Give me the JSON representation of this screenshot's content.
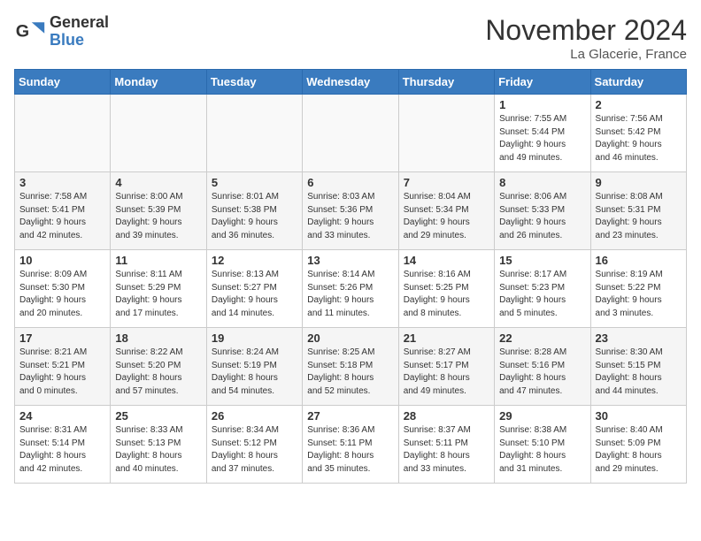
{
  "header": {
    "logo_line1": "General",
    "logo_line2": "Blue",
    "month": "November 2024",
    "location": "La Glacerie, France"
  },
  "days_of_week": [
    "Sunday",
    "Monday",
    "Tuesday",
    "Wednesday",
    "Thursday",
    "Friday",
    "Saturday"
  ],
  "weeks": [
    [
      {
        "day": "",
        "info": ""
      },
      {
        "day": "",
        "info": ""
      },
      {
        "day": "",
        "info": ""
      },
      {
        "day": "",
        "info": ""
      },
      {
        "day": "",
        "info": ""
      },
      {
        "day": "1",
        "info": "Sunrise: 7:55 AM\nSunset: 5:44 PM\nDaylight: 9 hours\nand 49 minutes."
      },
      {
        "day": "2",
        "info": "Sunrise: 7:56 AM\nSunset: 5:42 PM\nDaylight: 9 hours\nand 46 minutes."
      }
    ],
    [
      {
        "day": "3",
        "info": "Sunrise: 7:58 AM\nSunset: 5:41 PM\nDaylight: 9 hours\nand 42 minutes."
      },
      {
        "day": "4",
        "info": "Sunrise: 8:00 AM\nSunset: 5:39 PM\nDaylight: 9 hours\nand 39 minutes."
      },
      {
        "day": "5",
        "info": "Sunrise: 8:01 AM\nSunset: 5:38 PM\nDaylight: 9 hours\nand 36 minutes."
      },
      {
        "day": "6",
        "info": "Sunrise: 8:03 AM\nSunset: 5:36 PM\nDaylight: 9 hours\nand 33 minutes."
      },
      {
        "day": "7",
        "info": "Sunrise: 8:04 AM\nSunset: 5:34 PM\nDaylight: 9 hours\nand 29 minutes."
      },
      {
        "day": "8",
        "info": "Sunrise: 8:06 AM\nSunset: 5:33 PM\nDaylight: 9 hours\nand 26 minutes."
      },
      {
        "day": "9",
        "info": "Sunrise: 8:08 AM\nSunset: 5:31 PM\nDaylight: 9 hours\nand 23 minutes."
      }
    ],
    [
      {
        "day": "10",
        "info": "Sunrise: 8:09 AM\nSunset: 5:30 PM\nDaylight: 9 hours\nand 20 minutes."
      },
      {
        "day": "11",
        "info": "Sunrise: 8:11 AM\nSunset: 5:29 PM\nDaylight: 9 hours\nand 17 minutes."
      },
      {
        "day": "12",
        "info": "Sunrise: 8:13 AM\nSunset: 5:27 PM\nDaylight: 9 hours\nand 14 minutes."
      },
      {
        "day": "13",
        "info": "Sunrise: 8:14 AM\nSunset: 5:26 PM\nDaylight: 9 hours\nand 11 minutes."
      },
      {
        "day": "14",
        "info": "Sunrise: 8:16 AM\nSunset: 5:25 PM\nDaylight: 9 hours\nand 8 minutes."
      },
      {
        "day": "15",
        "info": "Sunrise: 8:17 AM\nSunset: 5:23 PM\nDaylight: 9 hours\nand 5 minutes."
      },
      {
        "day": "16",
        "info": "Sunrise: 8:19 AM\nSunset: 5:22 PM\nDaylight: 9 hours\nand 3 minutes."
      }
    ],
    [
      {
        "day": "17",
        "info": "Sunrise: 8:21 AM\nSunset: 5:21 PM\nDaylight: 9 hours\nand 0 minutes."
      },
      {
        "day": "18",
        "info": "Sunrise: 8:22 AM\nSunset: 5:20 PM\nDaylight: 8 hours\nand 57 minutes."
      },
      {
        "day": "19",
        "info": "Sunrise: 8:24 AM\nSunset: 5:19 PM\nDaylight: 8 hours\nand 54 minutes."
      },
      {
        "day": "20",
        "info": "Sunrise: 8:25 AM\nSunset: 5:18 PM\nDaylight: 8 hours\nand 52 minutes."
      },
      {
        "day": "21",
        "info": "Sunrise: 8:27 AM\nSunset: 5:17 PM\nDaylight: 8 hours\nand 49 minutes."
      },
      {
        "day": "22",
        "info": "Sunrise: 8:28 AM\nSunset: 5:16 PM\nDaylight: 8 hours\nand 47 minutes."
      },
      {
        "day": "23",
        "info": "Sunrise: 8:30 AM\nSunset: 5:15 PM\nDaylight: 8 hours\nand 44 minutes."
      }
    ],
    [
      {
        "day": "24",
        "info": "Sunrise: 8:31 AM\nSunset: 5:14 PM\nDaylight: 8 hours\nand 42 minutes."
      },
      {
        "day": "25",
        "info": "Sunrise: 8:33 AM\nSunset: 5:13 PM\nDaylight: 8 hours\nand 40 minutes."
      },
      {
        "day": "26",
        "info": "Sunrise: 8:34 AM\nSunset: 5:12 PM\nDaylight: 8 hours\nand 37 minutes."
      },
      {
        "day": "27",
        "info": "Sunrise: 8:36 AM\nSunset: 5:11 PM\nDaylight: 8 hours\nand 35 minutes."
      },
      {
        "day": "28",
        "info": "Sunrise: 8:37 AM\nSunset: 5:11 PM\nDaylight: 8 hours\nand 33 minutes."
      },
      {
        "day": "29",
        "info": "Sunrise: 8:38 AM\nSunset: 5:10 PM\nDaylight: 8 hours\nand 31 minutes."
      },
      {
        "day": "30",
        "info": "Sunrise: 8:40 AM\nSunset: 5:09 PM\nDaylight: 8 hours\nand 29 minutes."
      }
    ]
  ]
}
